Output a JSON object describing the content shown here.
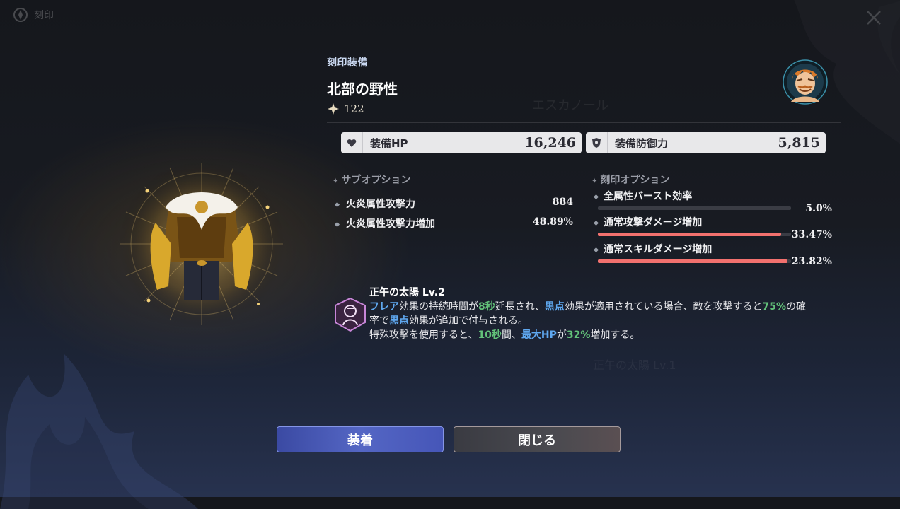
{
  "top_bar": {
    "label": "刻印"
  },
  "item": {
    "category": "刻印装備",
    "name": "北部の野性",
    "power": "122"
  },
  "main_stats": [
    {
      "icon": "heart-icon",
      "label": "装備HP",
      "value": "16,246"
    },
    {
      "icon": "shield-icon",
      "label": "装備防御力",
      "value": "5,815"
    }
  ],
  "sub_options": {
    "title": "サブオプション",
    "items": [
      {
        "label": "火炎属性攻撃力",
        "value": "884"
      },
      {
        "label": "火炎属性攻撃力増加",
        "value": "48.89%"
      }
    ]
  },
  "engrave_options": {
    "title": "刻印オプション",
    "items": [
      {
        "label": "全属性バースト効率",
        "value": "5.0%",
        "fill": 0.0
      },
      {
        "label": "通常攻撃ダメージ増加",
        "value": "33.47%",
        "fill": 0.95
      },
      {
        "label": "通常スキルダメージ増加",
        "value": "23.82%",
        "fill": 0.98
      }
    ]
  },
  "set_effect": {
    "title": "正午の太陽 Lv.2",
    "line1": {
      "kw1": "フレア",
      "t1": "効果の持続時間が",
      "n1": "8秒",
      "t2": "延長され、",
      "kw2": "黒点",
      "t3": "効果が適用されている場合、敵を攻撃すると",
      "n2": "75%",
      "t4": "の確"
    },
    "line2": {
      "t1": "率で",
      "kw1": "黒点",
      "t2": "効果が追加で付与される。"
    },
    "line3": {
      "t1": "特殊攻撃を使用すると、",
      "n1": "10秒",
      "t2": "間、",
      "kw1": "最大HP",
      "t3": "が",
      "n2": "32%",
      "t4": "増加する。"
    }
  },
  "background_text": {
    "ghost_name": "エスカノール",
    "ghost_skill": "正午の太陽 Lv.1"
  },
  "buttons": {
    "equip": "装着",
    "close": "閉じる"
  },
  "colors": {
    "keyword": "#5fa8f0",
    "number": "#63c27a",
    "bar_fill": "#f2716e",
    "equip_button": "#4b5cbd"
  }
}
